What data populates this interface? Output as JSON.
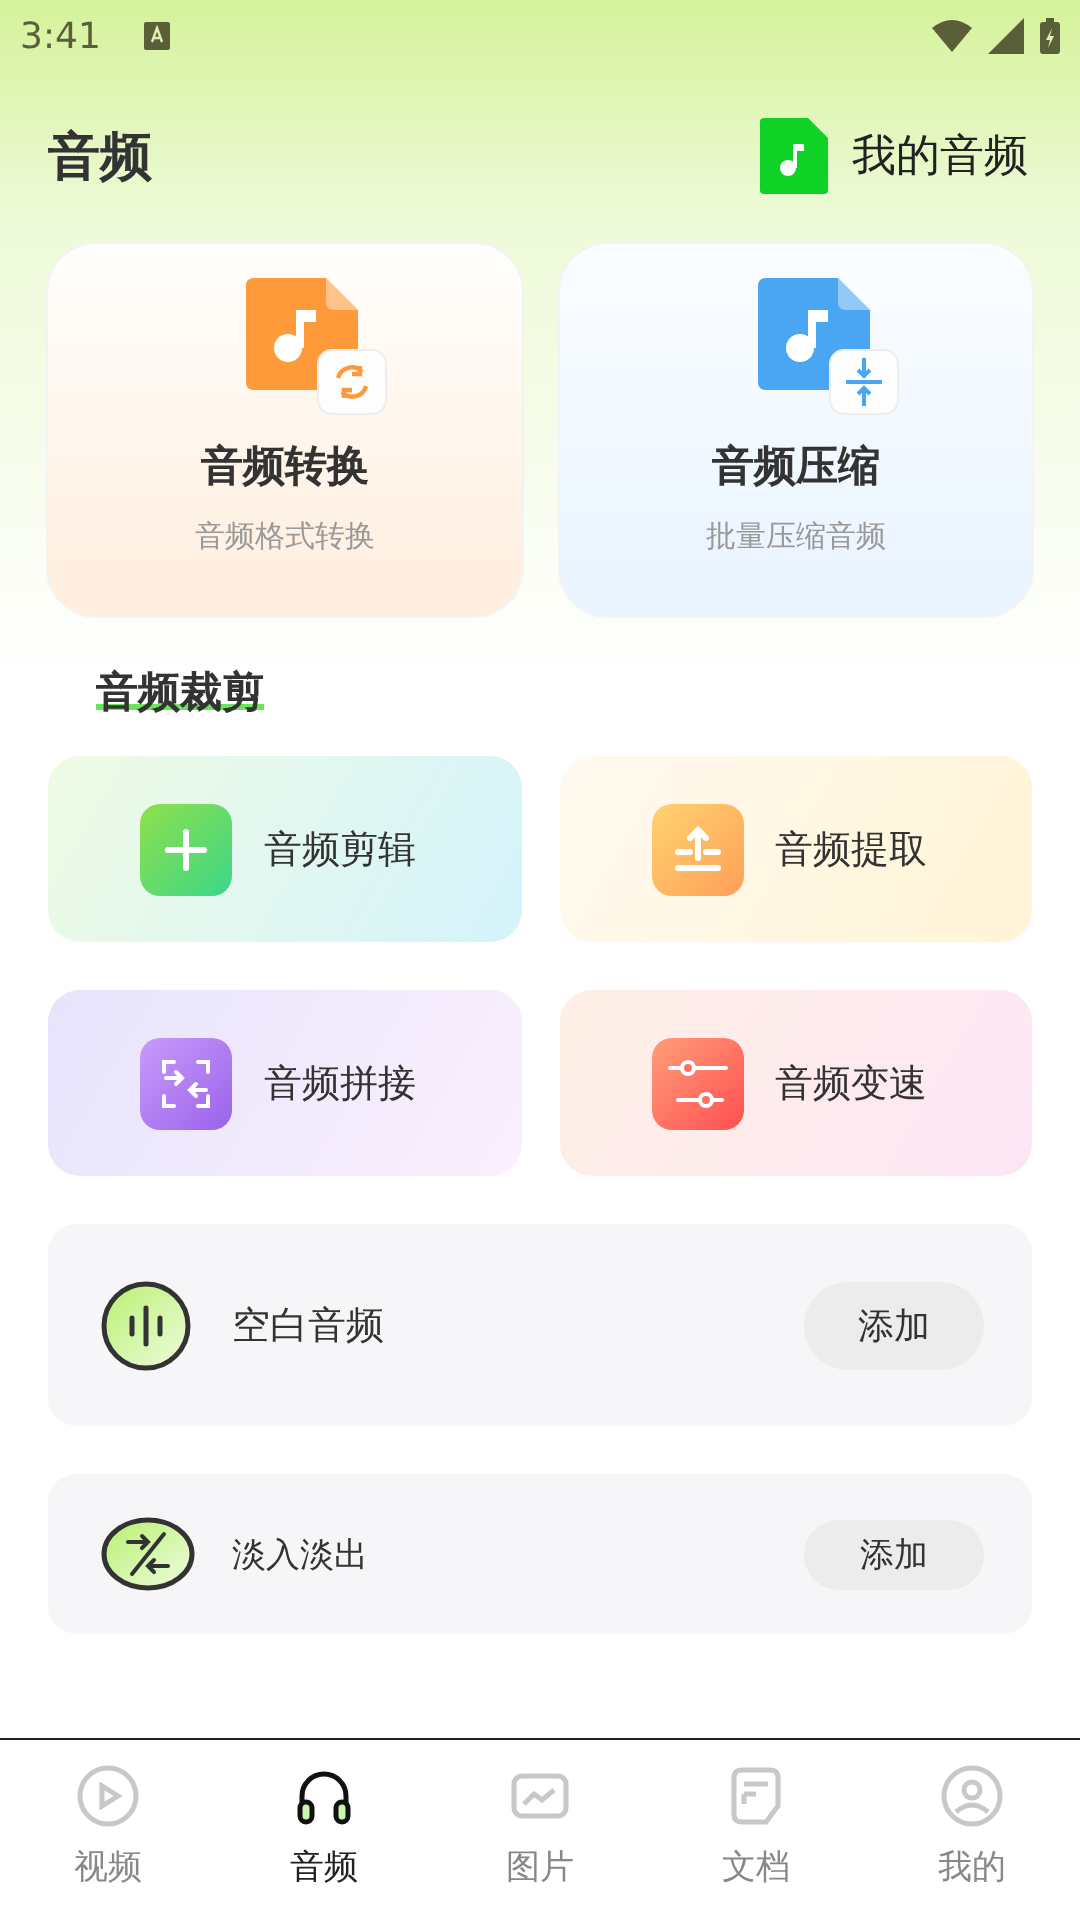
{
  "status_bar": {
    "time": "3:41"
  },
  "header": {
    "title": "音频",
    "my_audio": "我的音频"
  },
  "feature_cards": [
    {
      "title": "音频转换",
      "subtitle": "音频格式转换"
    },
    {
      "title": "音频压缩",
      "subtitle": "批量压缩音频"
    }
  ],
  "section_title": "音频裁剪",
  "tools": [
    {
      "label": "音频剪辑"
    },
    {
      "label": "音频提取"
    },
    {
      "label": "音频拼接"
    },
    {
      "label": "音频变速"
    }
  ],
  "list_items": [
    {
      "label": "空白音频",
      "button": "添加"
    },
    {
      "label": "淡入淡出",
      "button": "添加"
    }
  ],
  "nav": [
    {
      "label": "视频",
      "selected": false
    },
    {
      "label": "音频",
      "selected": true
    },
    {
      "label": "图片",
      "selected": false
    },
    {
      "label": "文档",
      "selected": false
    },
    {
      "label": "我的",
      "selected": false
    }
  ]
}
